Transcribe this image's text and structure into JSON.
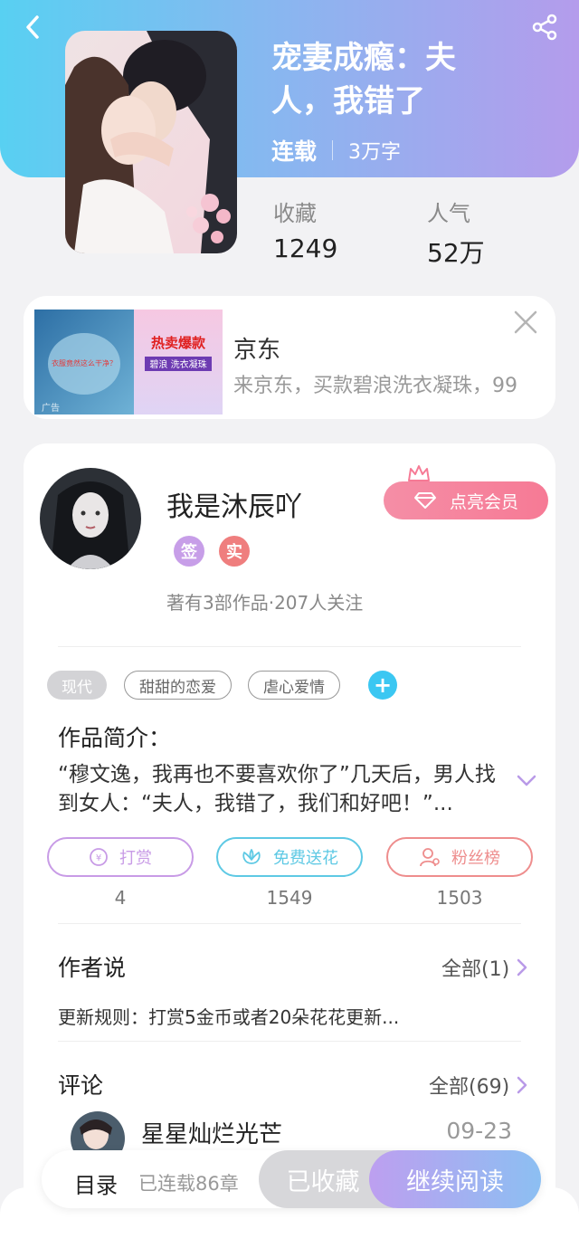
{
  "book": {
    "title": "宠妻成瘾：夫人，我错了",
    "status": "连载",
    "word_count": "3万字",
    "stats": [
      {
        "label": "收藏",
        "value": "1249"
      },
      {
        "label": "人气",
        "value": "52万"
      }
    ]
  },
  "ad": {
    "title": "京东",
    "description": "来京东，买款碧浪洗衣凝珠，99",
    "image_text": [
      "衣服竟然这么干净？",
      "热卖爆款",
      "碧浪 洗衣凝珠"
    ],
    "label": "广告"
  },
  "author": {
    "name": "我是沐辰吖",
    "badges": [
      "签",
      "实"
    ],
    "works": "著有3部作品·207人关注",
    "vip_button": "点亮会员"
  },
  "tags": [
    "现代",
    "甜甜的恋爱",
    "虐心爱情"
  ],
  "intro": {
    "title": "作品简介：",
    "text": "“穆文逸，我再也不要喜欢你了”几天后，男人找到女人：“夫人，我错了，我们和好吧！”..."
  },
  "actions": [
    {
      "label": "打赏",
      "count": "4",
      "color": "#c89be6"
    },
    {
      "label": "免费送花",
      "count": "1549",
      "color": "#5ec9e4"
    },
    {
      "label": "粉丝榜",
      "count": "1503",
      "color": "#ee8d8d"
    }
  ],
  "author_says": {
    "title": "作者说",
    "all_link": "全部(1)",
    "text": "更新规则：打赏5金币或者20朵花花更新..."
  },
  "comments": {
    "title": "评论",
    "all_link": "全部(69)",
    "first": {
      "user": "星星灿烂光芒",
      "date": "09-23"
    }
  },
  "bottom_bar": {
    "toc": "目录",
    "serial": "已连载86章",
    "favorited": "已收藏",
    "continue": "继续阅读"
  },
  "colors": {
    "header_gradient": [
      "#58d0f2",
      "#b49cec"
    ],
    "accent_purple": "#a98be6",
    "vip_pink": "#f67a95"
  }
}
